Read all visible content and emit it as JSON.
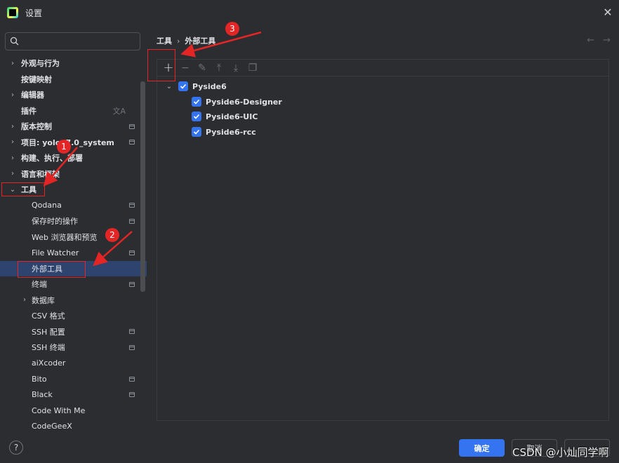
{
  "window": {
    "title": "设置"
  },
  "search": {
    "value": "",
    "placeholder": ""
  },
  "sidebar": {
    "items": [
      {
        "label": "外观与行为",
        "chevron": "right",
        "bold": true,
        "indent": 0,
        "badge": false
      },
      {
        "label": "按键映射",
        "chevron": "none",
        "bold": true,
        "indent": 0,
        "badge": false
      },
      {
        "label": "编辑器",
        "chevron": "right",
        "bold": true,
        "indent": 0,
        "badge": false
      },
      {
        "label": "插件",
        "chevron": "none",
        "bold": true,
        "indent": 0,
        "badge": false,
        "translate": true
      },
      {
        "label": "版本控制",
        "chevron": "right",
        "bold": true,
        "indent": 0,
        "badge": true
      },
      {
        "label": "项目: yolov7.0_system",
        "chevron": "right",
        "bold": true,
        "indent": 0,
        "badge": true
      },
      {
        "label": "构建、执行、部署",
        "chevron": "right",
        "bold": true,
        "indent": 0,
        "badge": false
      },
      {
        "label": "语言和框架",
        "chevron": "right",
        "bold": true,
        "indent": 0,
        "badge": false
      },
      {
        "label": "工具",
        "chevron": "down",
        "bold": true,
        "indent": 0,
        "badge": false
      },
      {
        "label": "Qodana",
        "chevron": "none",
        "bold": false,
        "indent": 1,
        "badge": true
      },
      {
        "label": "保存时的操作",
        "chevron": "none",
        "bold": false,
        "indent": 1,
        "badge": true
      },
      {
        "label": "Web 浏览器和预览",
        "chevron": "none",
        "bold": false,
        "indent": 1,
        "badge": false
      },
      {
        "label": "File Watcher",
        "chevron": "none",
        "bold": false,
        "indent": 1,
        "badge": true
      },
      {
        "label": "外部工具",
        "chevron": "none",
        "bold": false,
        "indent": 1,
        "badge": false,
        "selected": true
      },
      {
        "label": "终端",
        "chevron": "none",
        "bold": false,
        "indent": 1,
        "badge": true
      },
      {
        "label": "数据库",
        "chevron": "right",
        "bold": false,
        "indent": 1,
        "badge": false
      },
      {
        "label": "CSV 格式",
        "chevron": "none",
        "bold": false,
        "indent": 1,
        "badge": false
      },
      {
        "label": "SSH 配置",
        "chevron": "none",
        "bold": false,
        "indent": 1,
        "badge": true
      },
      {
        "label": "SSH 终端",
        "chevron": "none",
        "bold": false,
        "indent": 1,
        "badge": true
      },
      {
        "label": "aiXcoder",
        "chevron": "none",
        "bold": false,
        "indent": 1,
        "badge": false
      },
      {
        "label": "Bito",
        "chevron": "none",
        "bold": false,
        "indent": 1,
        "badge": true
      },
      {
        "label": "Black",
        "chevron": "none",
        "bold": false,
        "indent": 1,
        "badge": true
      },
      {
        "label": "Code With Me",
        "chevron": "none",
        "bold": false,
        "indent": 1,
        "badge": false
      },
      {
        "label": "CodeGeeX",
        "chevron": "none",
        "bold": false,
        "indent": 1,
        "badge": false
      }
    ]
  },
  "breadcrumb": {
    "parent": "工具",
    "separator": "›",
    "current": "外部工具"
  },
  "nav": {
    "back": "←",
    "forward": "→"
  },
  "toolbar": {
    "add": "+",
    "remove": "−",
    "edit": "✎",
    "up": "⤒",
    "down": "⤓",
    "copy": "❐"
  },
  "tools": {
    "group": {
      "label": "Pyside6",
      "checked": true
    },
    "children": [
      {
        "label": "Pyside6-Designer",
        "checked": true
      },
      {
        "label": "Pyside6-UIC",
        "checked": true
      },
      {
        "label": "Pyside6-rcc",
        "checked": true
      }
    ]
  },
  "footer": {
    "help": "?",
    "ok": "确定",
    "cancel": "取消"
  },
  "watermark": "CSDN @小灿同学啊",
  "annotations": [
    "1",
    "2",
    "3"
  ],
  "colors": {
    "accent": "#3574f0",
    "selection": "#2e436e",
    "annotation": "#e32525",
    "background": "#2b2d30"
  }
}
